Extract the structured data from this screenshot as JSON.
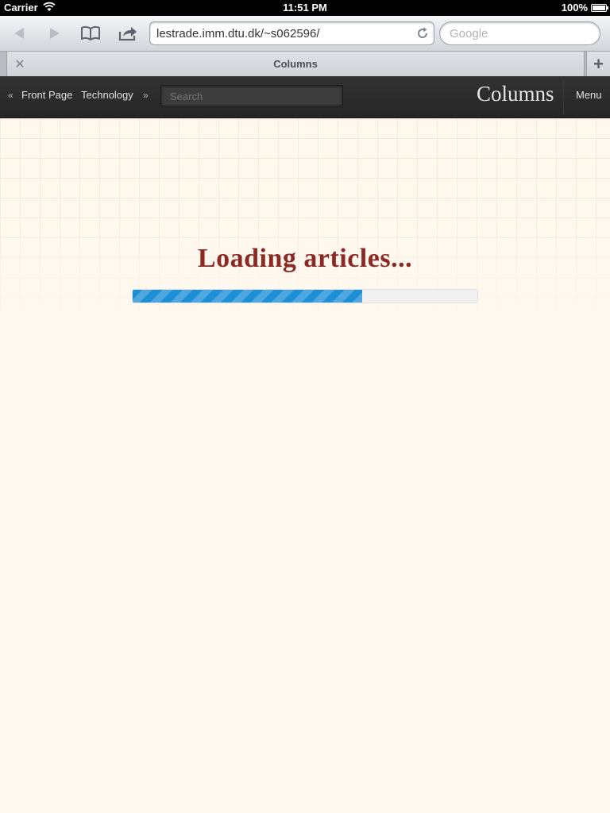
{
  "status_bar": {
    "carrier": "Carrier",
    "time": "11:51 PM",
    "battery": "100%"
  },
  "browser": {
    "url": "lestrade.imm.dtu.dk/~s062596/",
    "search_placeholder": "Google",
    "tab_title": "Columns"
  },
  "site_nav": {
    "prev_arrow": "«",
    "items": [
      {
        "label": "Front Page"
      },
      {
        "label": "Technology"
      }
    ],
    "next_arrow": "»",
    "search_placeholder": "Search",
    "logo": "Columns",
    "menu_label": "Menu"
  },
  "loading": {
    "title": "Loading articles...",
    "progress_percent": 66.5,
    "bar_color": "#1c8fd6"
  },
  "colors": {
    "page_background": "#fff8ee",
    "title_color": "#8b2a24",
    "nav_background": "#2c2c2c"
  }
}
